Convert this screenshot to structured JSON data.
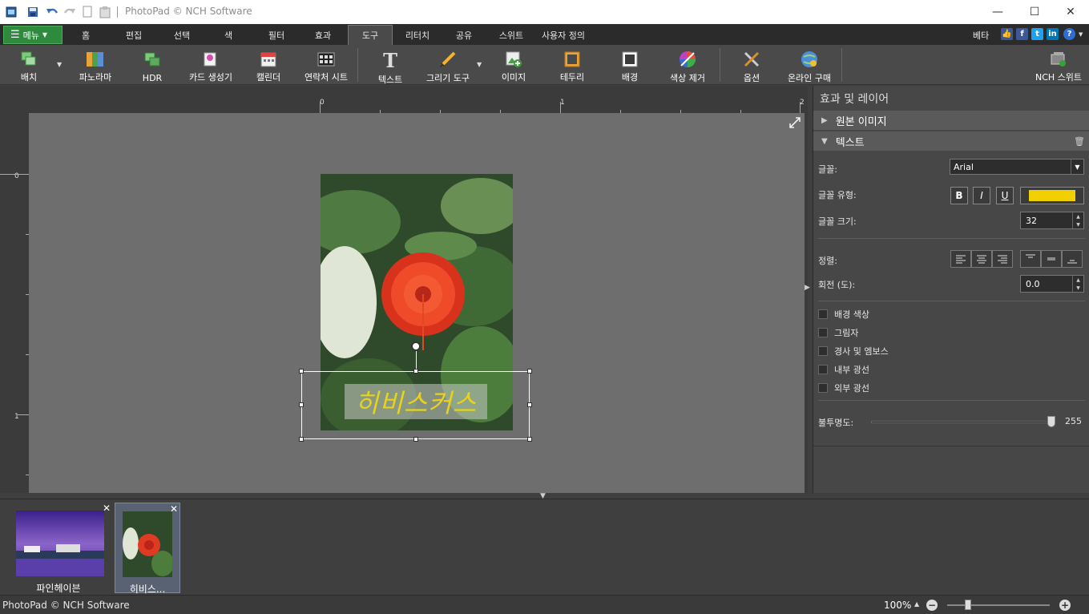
{
  "window": {
    "title": "PhotoPad © NCH Software",
    "min": "—",
    "max": "☐",
    "close": "✕"
  },
  "menubar": {
    "menu_label": "메뉴",
    "tabs": [
      {
        "label": "홈"
      },
      {
        "label": "편집"
      },
      {
        "label": "선택"
      },
      {
        "label": "색"
      },
      {
        "label": "필터"
      },
      {
        "label": "효과"
      },
      {
        "label": "도구"
      },
      {
        "label": "리터치"
      },
      {
        "label": "공유"
      },
      {
        "label": "스위트"
      },
      {
        "label": "사용자 정의"
      }
    ],
    "active_tab": "도구",
    "beta": "베타"
  },
  "toolbar": {
    "items": [
      {
        "label": "배치",
        "icon": "batch-icon"
      },
      {
        "label": "파노라마",
        "icon": "panorama-icon"
      },
      {
        "label": "HDR",
        "icon": "hdr-icon"
      },
      {
        "label": "카드 생성기",
        "icon": "card-maker-icon"
      },
      {
        "label": "캘린더",
        "icon": "calendar-icon"
      },
      {
        "label": "연락처 시트",
        "icon": "contact-sheet-icon"
      },
      {
        "label": "텍스트",
        "icon": "text-icon"
      },
      {
        "label": "그리기 도구",
        "icon": "pencil-icon"
      },
      {
        "label": "이미지",
        "icon": "image-icon"
      },
      {
        "label": "테두리",
        "icon": "border-icon"
      },
      {
        "label": "배경",
        "icon": "background-icon"
      },
      {
        "label": "색상 제거",
        "icon": "color-remove-icon"
      },
      {
        "label": "옵션",
        "icon": "options-icon"
      },
      {
        "label": "온라인 구매",
        "icon": "buy-online-icon"
      },
      {
        "label": "NCH 스위트",
        "icon": "nch-suite-icon"
      }
    ]
  },
  "canvas": {
    "ruler_top": [
      "0",
      "1",
      "2"
    ],
    "ruler_left": [
      "0",
      "1"
    ],
    "overlay_text": "히비스커스"
  },
  "panel": {
    "title": "효과 및 레이어",
    "layer_original": "원본 이미지",
    "layer_text": "텍스트",
    "font_label": "글꼴:",
    "font_value": "Arial",
    "font_style_label": "글꼴 유형:",
    "bold": "B",
    "italic": "I",
    "underline": "U",
    "text_color": "#f0d000",
    "font_size_label": "글꼴 크기:",
    "font_size": "32",
    "align_label": "정렬:",
    "rotation_label": "회전 (도):",
    "rotation": "0.0",
    "checkboxes": [
      {
        "label": "배경 색상"
      },
      {
        "label": "그림자"
      },
      {
        "label": "경사 및 엠보스"
      },
      {
        "label": "내부 광선"
      },
      {
        "label": "외부 광선"
      }
    ],
    "opacity_label": "불투명도:",
    "opacity": "255"
  },
  "filmstrip": {
    "items": [
      {
        "caption": "파인헤이븐"
      },
      {
        "caption": "히비스..."
      }
    ]
  },
  "status": {
    "app": "PhotoPad © NCH Software",
    "zoom": "100%"
  }
}
